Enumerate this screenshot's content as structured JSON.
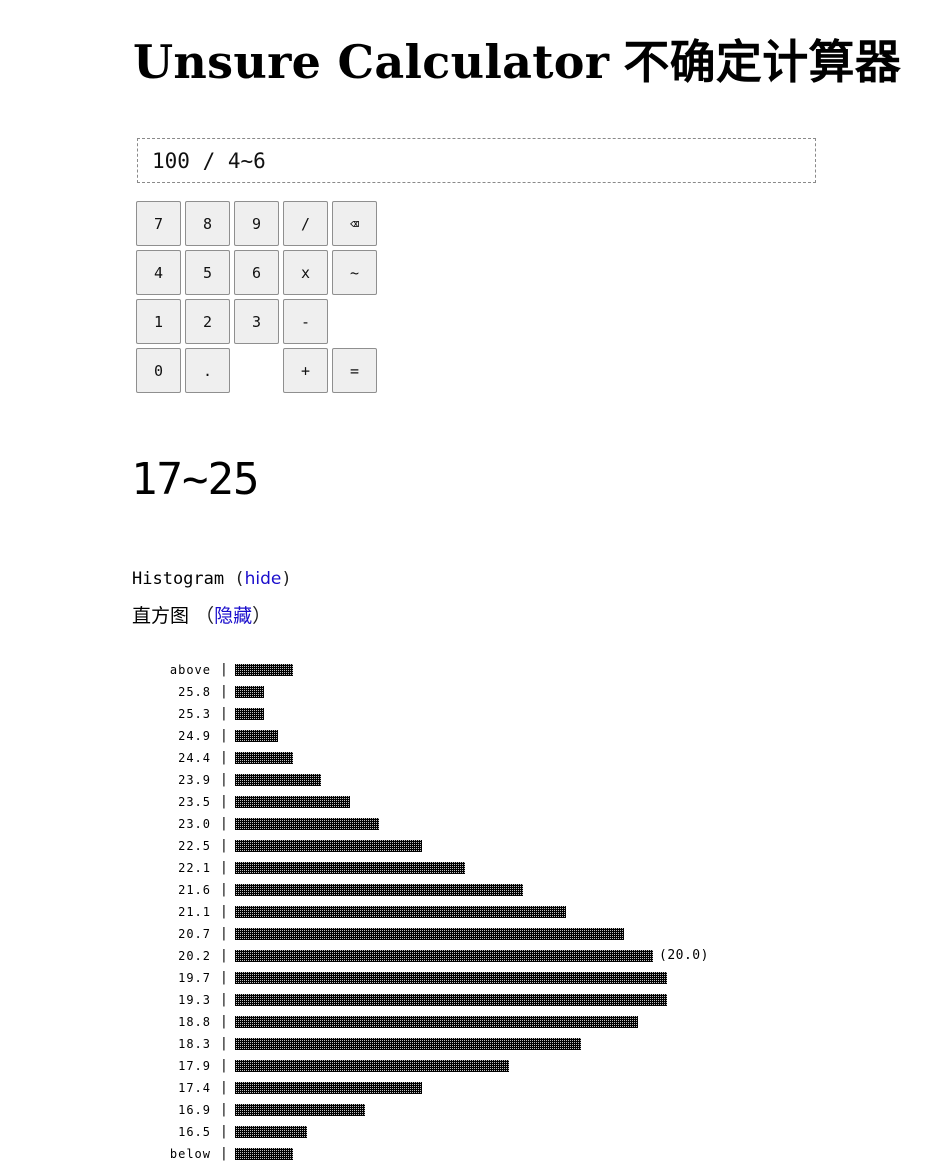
{
  "page": {
    "title_en": "Unsure Calculator",
    "title_zh": "不确定计算器"
  },
  "calculator": {
    "expression": "100 / 4~6",
    "keys": [
      {
        "label": "7",
        "name": "key-7"
      },
      {
        "label": "8",
        "name": "key-8"
      },
      {
        "label": "9",
        "name": "key-9"
      },
      {
        "label": "/",
        "name": "key-divide"
      },
      {
        "label": "⌫",
        "name": "backspace-key"
      },
      {
        "label": "4",
        "name": "key-4"
      },
      {
        "label": "5",
        "name": "key-5"
      },
      {
        "label": "6",
        "name": "key-6"
      },
      {
        "label": "x",
        "name": "key-multiply"
      },
      {
        "label": "~",
        "name": "key-range"
      },
      {
        "label": "1",
        "name": "key-1"
      },
      {
        "label": "2",
        "name": "key-2"
      },
      {
        "label": "3",
        "name": "key-3"
      },
      {
        "label": "-",
        "name": "key-subtract"
      },
      {
        "label": "0",
        "name": "key-0"
      },
      {
        "label": ".",
        "name": "key-decimal"
      },
      {
        "label": "+",
        "name": "key-add"
      },
      {
        "label": "=",
        "name": "key-equals"
      }
    ]
  },
  "result": {
    "value": "17~25"
  },
  "histogram": {
    "label_en": "Histogram",
    "hide_en": "hide",
    "label_zh": "直方图",
    "hide_zh": "隐藏",
    "separator": "|",
    "bins": [
      {
        "label": "above",
        "count": 4
      },
      {
        "label": "25.8",
        "count": 2
      },
      {
        "label": "25.3",
        "count": 2
      },
      {
        "label": "24.9",
        "count": 3
      },
      {
        "label": "24.4",
        "count": 4
      },
      {
        "label": "23.9",
        "count": 6
      },
      {
        "label": "23.5",
        "count": 8
      },
      {
        "label": "23.0",
        "count": 10
      },
      {
        "label": "22.5",
        "count": 13
      },
      {
        "label": "22.1",
        "count": 16
      },
      {
        "label": "21.6",
        "count": 20
      },
      {
        "label": "21.1",
        "count": 23
      },
      {
        "label": "20.7",
        "count": 27
      },
      {
        "label": "20.2",
        "count": 29,
        "note": "(20.0)"
      },
      {
        "label": "19.7",
        "count": 30
      },
      {
        "label": "19.3",
        "count": 30
      },
      {
        "label": "18.8",
        "count": 28
      },
      {
        "label": "18.3",
        "count": 24
      },
      {
        "label": "17.9",
        "count": 19
      },
      {
        "label": "17.4",
        "count": 13
      },
      {
        "label": "16.9",
        "count": 9
      },
      {
        "label": "16.5",
        "count": 5
      },
      {
        "label": "below",
        "count": 4
      }
    ]
  }
}
